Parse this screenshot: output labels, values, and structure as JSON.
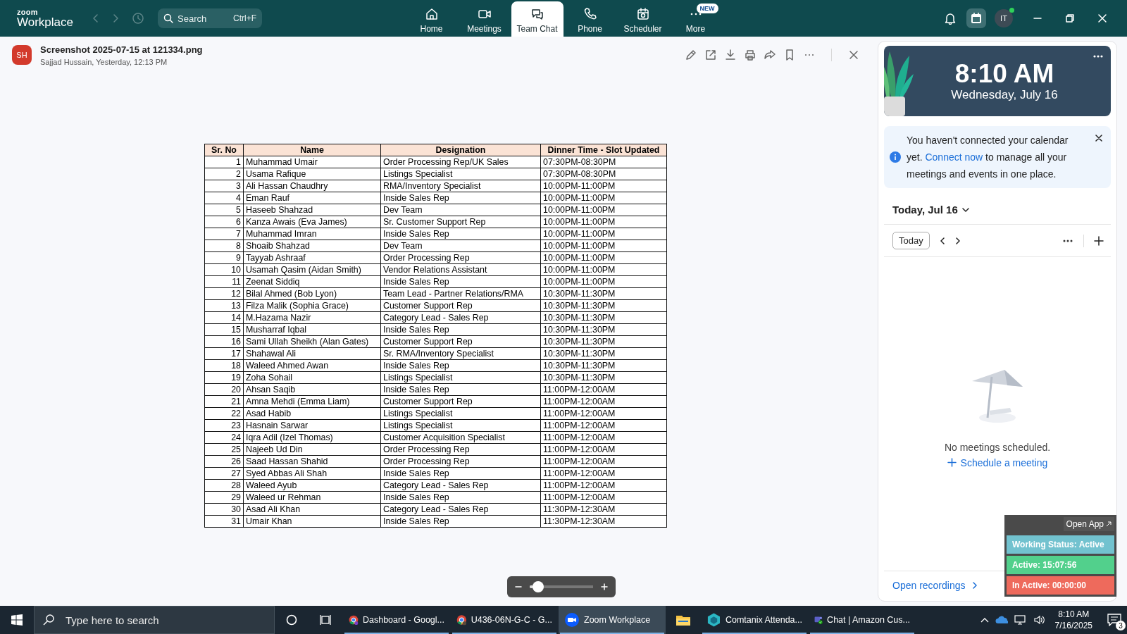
{
  "app": {
    "logo_top": "zoom",
    "logo_bottom": "Workplace"
  },
  "search": {
    "placeholder": "Search",
    "shortcut": "Ctrl+F"
  },
  "nav_tabs": [
    {
      "label": "Home",
      "selected": false
    },
    {
      "label": "Meetings",
      "selected": false
    },
    {
      "label": "Team Chat",
      "selected": true
    },
    {
      "label": "Phone",
      "selected": false
    },
    {
      "label": "Scheduler",
      "selected": false
    },
    {
      "label": "More",
      "selected": false,
      "badge": "NEW"
    }
  ],
  "user": {
    "initials": "IT",
    "online": true
  },
  "file_viewer": {
    "avatar": "SH",
    "title": "Screenshot 2025-07-15 at 121334.png",
    "subtitle": "Sajjad Hussain, Yesterday, 12:13 PM",
    "zoom": {
      "level": 0.05
    }
  },
  "table": {
    "columns": [
      "Sr. No",
      "Name",
      "Designation",
      "Dinner Time - Slot Updated"
    ],
    "rows": [
      [
        "1",
        "Muhammad Umair",
        "Order Processing Rep/UK Sales",
        "07:30PM-08:30PM"
      ],
      [
        "2",
        "Usama Rafique",
        "Listings Specialist",
        "07:30PM-08:30PM"
      ],
      [
        "3",
        "Ali Hassan Chaudhry",
        "RMA/Inventory Specialist",
        "10:00PM-11:00PM"
      ],
      [
        "4",
        "Eman Rauf",
        "Inside Sales Rep",
        "10:00PM-11:00PM"
      ],
      [
        "5",
        "Haseeb Shahzad",
        "Dev Team",
        "10:00PM-11:00PM"
      ],
      [
        "6",
        "Kanza Awais (Eva James)",
        "Sr. Customer Support Rep",
        "10:00PM-11:00PM"
      ],
      [
        "7",
        "Muhammad Imran",
        "Inside Sales Rep",
        "10:00PM-11:00PM"
      ],
      [
        "8",
        "Shoaib Shahzad",
        "Dev Team",
        "10:00PM-11:00PM"
      ],
      [
        "9",
        "Tayyab Ashraaf",
        "Order Processing Rep",
        "10:00PM-11:00PM"
      ],
      [
        "10",
        "Usamah Qasim (Aidan Smith)",
        "Vendor Relations Assistant",
        "10:00PM-11:00PM"
      ],
      [
        "11",
        "Zeenat Siddiq",
        "Inside Sales Rep",
        "10:00PM-11:00PM"
      ],
      [
        "12",
        "Bilal Ahmed (Bob Lyon)",
        "Team Lead - Partner Relations/RMA",
        "10:30PM-11:30PM"
      ],
      [
        "13",
        "Filza Malik (Sophia Grace)",
        "Customer Support Rep",
        "10:30PM-11:30PM"
      ],
      [
        "14",
        "M.Hazama Nazir",
        "Category Lead - Sales Rep",
        "10:30PM-11:30PM"
      ],
      [
        "15",
        "Musharraf Iqbal",
        "Inside Sales Rep",
        "10:30PM-11:30PM"
      ],
      [
        "16",
        "Sami Ullah Sheikh (Alan Gates)",
        "Customer Support Rep",
        "10:30PM-11:30PM"
      ],
      [
        "17",
        "Shahawal Ali",
        "Sr. RMA/Inventory Specialist",
        "10:30PM-11:30PM"
      ],
      [
        "18",
        "Waleed Ahmed Awan",
        "Inside Sales Rep",
        "10:30PM-11:30PM"
      ],
      [
        "19",
        "Zoha Sohail",
        "Listings Specialist",
        "10:30PM-11:30PM"
      ],
      [
        "20",
        "Ahsan Saqib",
        "Inside Sales Rep",
        "11:00PM-12:00AM"
      ],
      [
        "21",
        "Amna Mehdi (Emma Liam)",
        "Customer Support Rep",
        "11:00PM-12:00AM"
      ],
      [
        "22",
        "Asad Habib",
        "Listings Specialist",
        "11:00PM-12:00AM"
      ],
      [
        "23",
        "Hasnain Sarwar",
        "Listings Specialist",
        "11:00PM-12:00AM"
      ],
      [
        "24",
        "Iqra Adil (Izel Thomas)",
        "Customer Acquisition Specialist",
        "11:00PM-12:00AM"
      ],
      [
        "25",
        "Najeeb Ud Din",
        "Order Processing Rep",
        "11:00PM-12:00AM"
      ],
      [
        "26",
        "Saad Hassan Shahid",
        "Order Processing Rep",
        "11:00PM-12:00AM"
      ],
      [
        "27",
        "Syed Abbas Ali Shah",
        "Inside Sales Rep",
        "11:00PM-12:00AM"
      ],
      [
        "28",
        "Waleed Ayub",
        "Category Lead - Sales Rep",
        "11:00PM-12:00AM"
      ],
      [
        "29",
        "Waleed ur Rehman",
        "Inside Sales Rep",
        "11:00PM-12:00AM"
      ],
      [
        "30",
        "Asad Ali Khan",
        "Category Lead - Sales Rep",
        "11:30PM-12:30AM"
      ],
      [
        "31",
        "Umair Khan",
        "Inside Sales Rep",
        "11:30PM-12:30AM"
      ]
    ]
  },
  "calendar": {
    "time": "8:10 AM",
    "date": "Wednesday, July 16",
    "notice": {
      "text_before": "You haven't connected your calendar yet.",
      "link": "Connect now",
      "text_after": "to manage all your meetings and events in one place."
    },
    "day_heading": "Today, Jul 16",
    "today_button": "Today",
    "empty_text": "No meetings scheduled.",
    "schedule_link": "Schedule a meeting",
    "recordings_link": "Open recordings"
  },
  "status_widget": {
    "open_app": "Open App",
    "items": [
      {
        "label": "Working Status: Active",
        "color": "#72c2cf"
      },
      {
        "label": "Active: 15:07:56",
        "color": "#52d08c"
      },
      {
        "label": "In Active: 00:00:00",
        "color": "#ee6a5c"
      }
    ]
  },
  "taskbar": {
    "search_placeholder": "Type here to search",
    "apps": [
      {
        "kind": "window",
        "label": "Dashboard - Googl...",
        "selected": false
      },
      {
        "kind": "window",
        "label": "U436-06N-G-C - G...",
        "selected": false
      },
      {
        "kind": "window",
        "label": "Zoom Workplace",
        "selected": true
      },
      {
        "kind": "pinned",
        "selected": false
      },
      {
        "kind": "window",
        "label": "Comtanix Attenda...",
        "selected": false
      },
      {
        "kind": "window",
        "label": "Chat | Amazon Cus...",
        "selected": false
      }
    ],
    "time": "8:10 AM",
    "date": "7/16/2025",
    "notifications": "3"
  }
}
